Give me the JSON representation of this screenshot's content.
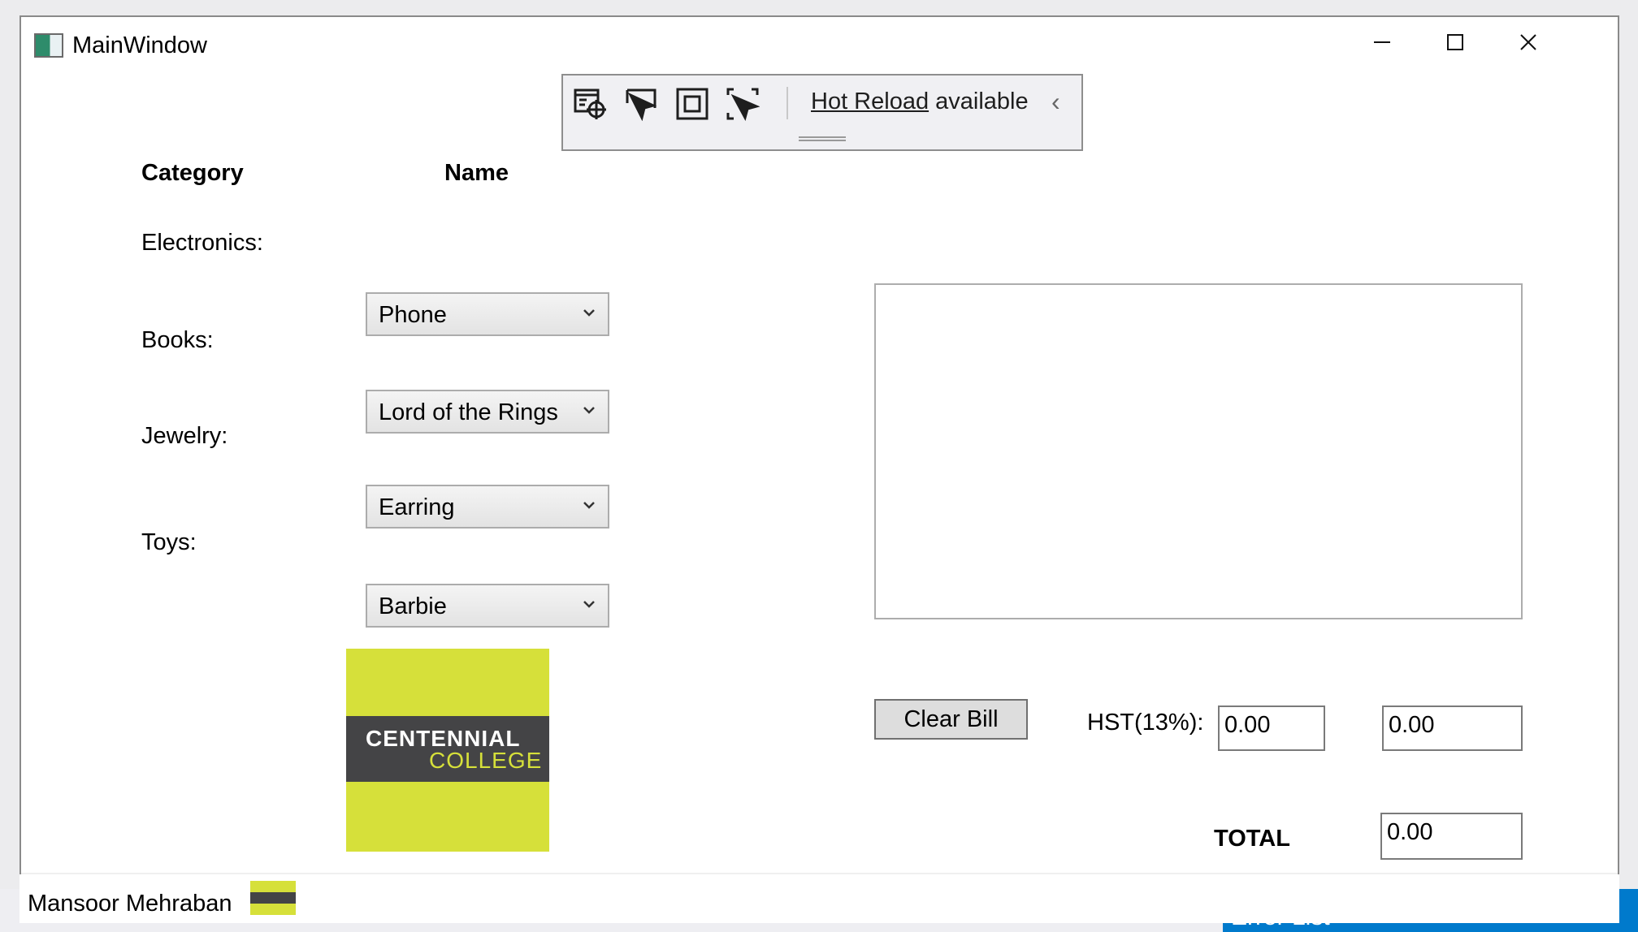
{
  "window": {
    "title": "MainWindow"
  },
  "hot_reload": {
    "link_text": "Hot Reload",
    "suffix": " available"
  },
  "headers": {
    "category": "Category",
    "name": "Name"
  },
  "categories": [
    {
      "label": "Electronics:",
      "selected": "Phone"
    },
    {
      "label": "Books:",
      "selected": "Lord of the Rings"
    },
    {
      "label": "Jewelry:",
      "selected": "Earring"
    },
    {
      "label": "Toys:",
      "selected": "Barbie"
    }
  ],
  "logo": {
    "line1": "CENTENNIAL",
    "line2": "COLLEGE"
  },
  "bill": {
    "clear_label": "Clear Bill",
    "hst_label": "HST(13%):",
    "hst_value": "0.00",
    "subtotal_value": "0.00",
    "total_label": "TOTAL",
    "total_value": "0.00"
  },
  "footer": {
    "author": "Mansoor Mehraban"
  },
  "ide": {
    "error_list": "Error List"
  }
}
